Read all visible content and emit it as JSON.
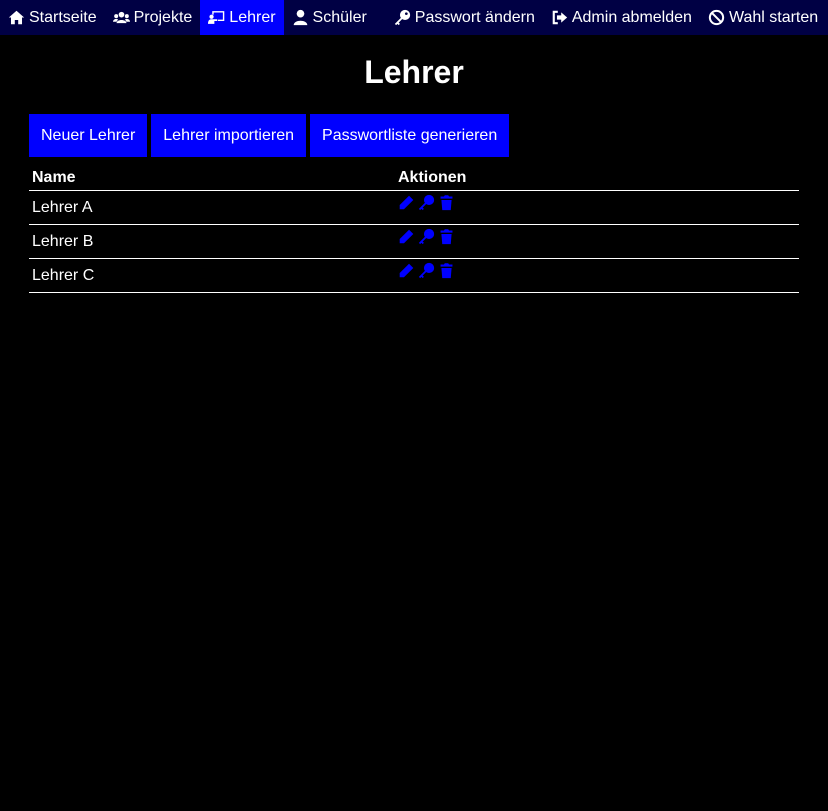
{
  "nav": {
    "items": [
      {
        "label": "Startseite",
        "icon": "home-icon"
      },
      {
        "label": "Projekte",
        "icon": "users-icon"
      },
      {
        "label": "Lehrer",
        "icon": "chalkboard-teacher-icon",
        "active": true
      },
      {
        "label": "Schüler",
        "icon": "user-icon"
      },
      {
        "label": "Passwort ändern",
        "icon": "key-icon"
      },
      {
        "label": "Admin abmelden",
        "icon": "sign-out-icon"
      },
      {
        "label": "Wahl starten",
        "icon": "ban-icon"
      }
    ]
  },
  "page": {
    "title": "Lehrer"
  },
  "toolbar": {
    "new_label": "Neuer Lehrer",
    "import_label": "Lehrer importieren",
    "password_list_label": "Passwortliste generieren"
  },
  "table": {
    "headers": [
      "Name",
      "Aktionen"
    ],
    "rows": [
      {
        "name": "Lehrer A"
      },
      {
        "name": "Lehrer B"
      },
      {
        "name": "Lehrer C"
      }
    ]
  },
  "colors": {
    "background": "#000000",
    "navbar": "#000044",
    "accent": "#0000ff",
    "text": "#ffffff"
  }
}
